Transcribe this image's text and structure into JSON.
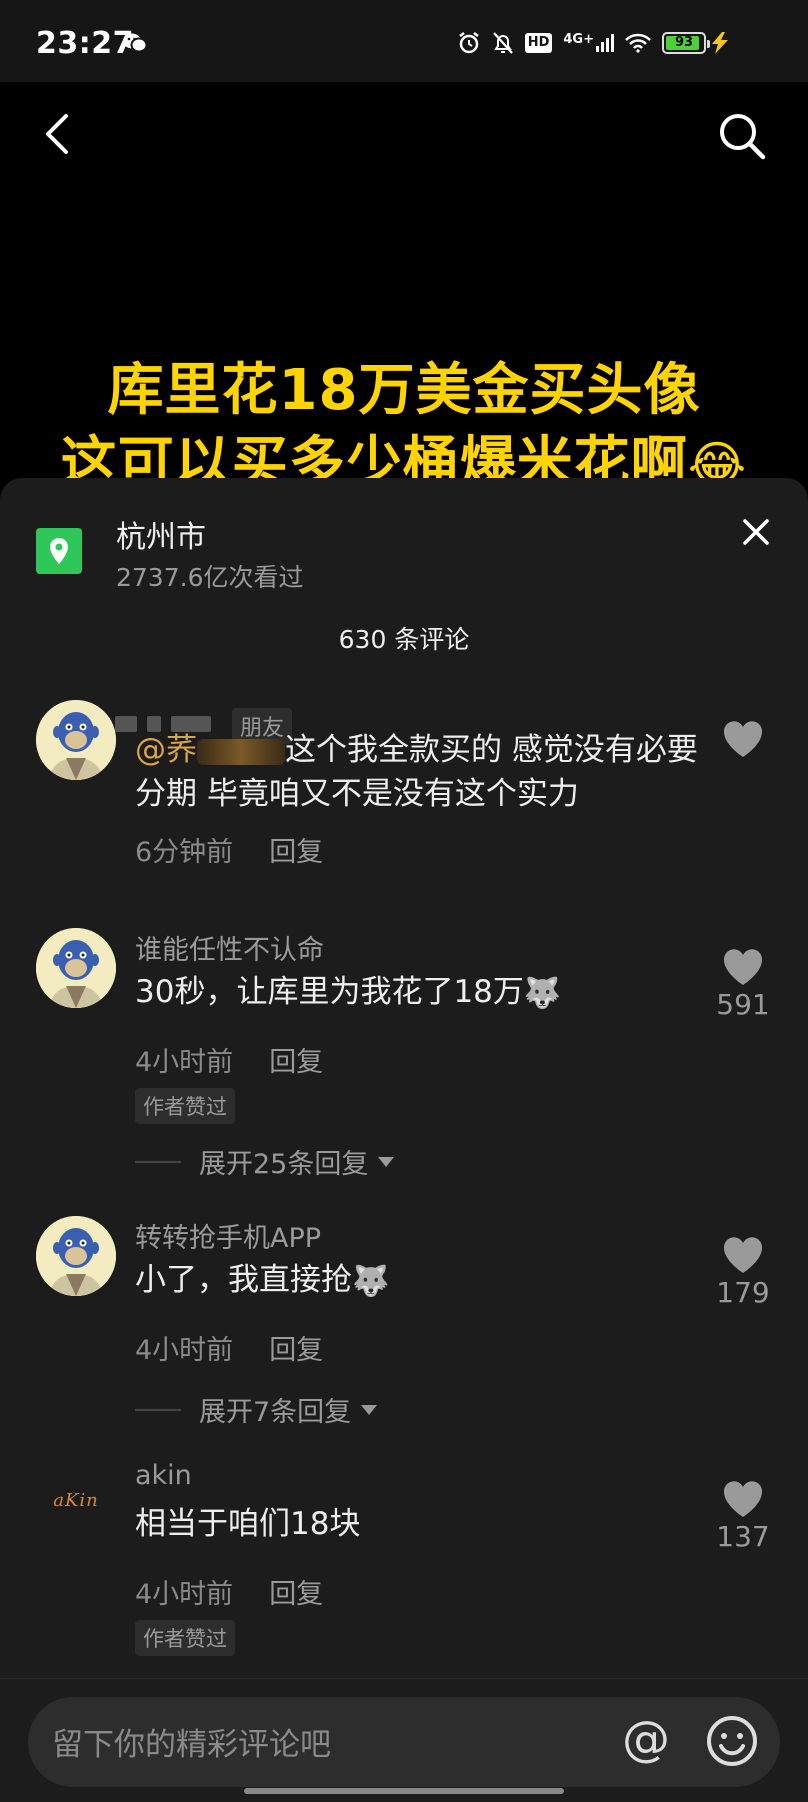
{
  "status_bar": {
    "time": "23:27",
    "network": "4G+",
    "hd": "HD",
    "battery": "93",
    "battery_fraction": 0.93
  },
  "video": {
    "caption_line1": "库里花18万美金买头像",
    "caption_line2": "这可以买多少桶爆米花啊",
    "caption_emoji": "😂"
  },
  "sheet": {
    "location": "杭州市",
    "views": "2737.6亿次看过",
    "comment_count": "630 条评论"
  },
  "comments": [
    {
      "username": "",
      "tag": "朋友",
      "mention": "@荞",
      "text": "这个我全款买的 感觉没有必要分期 毕竟咱又不是没有这个实力",
      "time": "6分钟前",
      "reply": "回复",
      "likes": ""
    },
    {
      "username": "谁能任性不认命",
      "text": "30秒，让库里为我花了18万",
      "emoji": "🐺",
      "time": "4小时前",
      "reply": "回复",
      "author_liked": "作者赞过",
      "expand": "展开25条回复",
      "likes": "591"
    },
    {
      "username": "转转抢手机APP",
      "text": "小了，我直接抢",
      "emoji": "🐺",
      "time": "4小时前",
      "reply": "回复",
      "expand": "展开7条回复",
      "likes": "179"
    },
    {
      "username": "akin",
      "avatar_text": "aKin",
      "text": "相当于咱们18块",
      "time": "4小时前",
      "reply": "回复",
      "author_liked": "作者赞过",
      "likes": "137"
    }
  ],
  "input": {
    "placeholder": "留下你的精彩评论吧",
    "at_icon": "@"
  },
  "colors": {
    "caption": "#ffd400",
    "mention": "#d9a54b",
    "location_icon": "#2fc75a",
    "battery": "#4cd137"
  }
}
